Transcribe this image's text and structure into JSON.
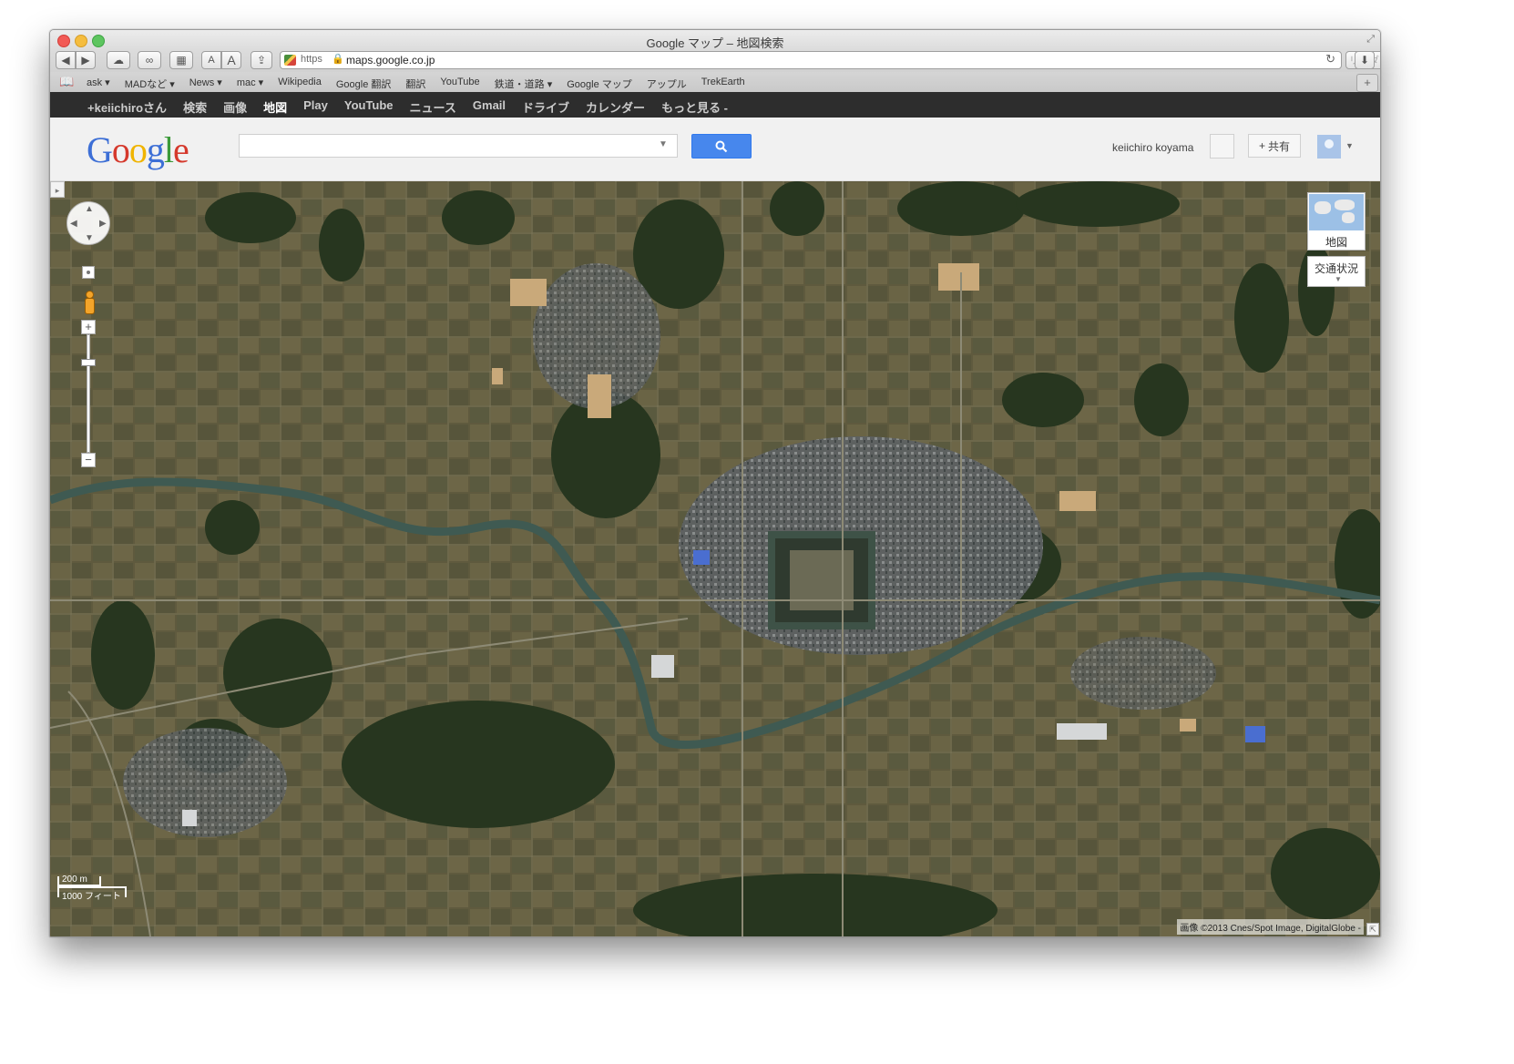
{
  "window": {
    "title": "Google マップ – 地図検索"
  },
  "toolbar": {
    "back_icon": "back-arrow-icon",
    "forward_icon": "forward-arrow-icon",
    "icloud_icon": "cloud-icon",
    "reading_list_icon": "glasses-icon",
    "top_sites_icon": "grid-icon",
    "font_small": "A",
    "font_large": "A",
    "share_icon": "share-icon",
    "url_scheme": "https",
    "url": "maps.google.co.jp",
    "reader_label": "リーダー"
  },
  "bookmarks": {
    "items": [
      "ask ▾",
      "MADなど ▾",
      "News ▾",
      "mac ▾",
      "Wikipedia",
      "Google 翻訳",
      "翻訳",
      "YouTube",
      "鉄道・道路 ▾",
      "Google マップ",
      "アップル",
      "TrekEarth"
    ]
  },
  "gbar": {
    "items": [
      "+keiichiroさん",
      "検索",
      "画像",
      "地図",
      "Play",
      "YouTube",
      "ニュース",
      "Gmail",
      "ドライブ",
      "カレンダー",
      "もっと見る -"
    ],
    "active_index": 3
  },
  "header": {
    "logo": "Google",
    "search_value": "",
    "search_button_icon": "magnifier-icon",
    "username": "keiichiro koyama",
    "share_label": "共有"
  },
  "map": {
    "maptype_label": "地図",
    "traffic_label": "交通状況",
    "scale_metric": "200 m",
    "scale_imperial": "1000 フィート",
    "attribution": "画像 ©2013 Cnes/Spot Image, DigitalGlobe -"
  },
  "colors": {
    "gbar_bg": "#2d2d2d",
    "search_button": "#4787ed",
    "map_fields": "#5f5b3f"
  }
}
